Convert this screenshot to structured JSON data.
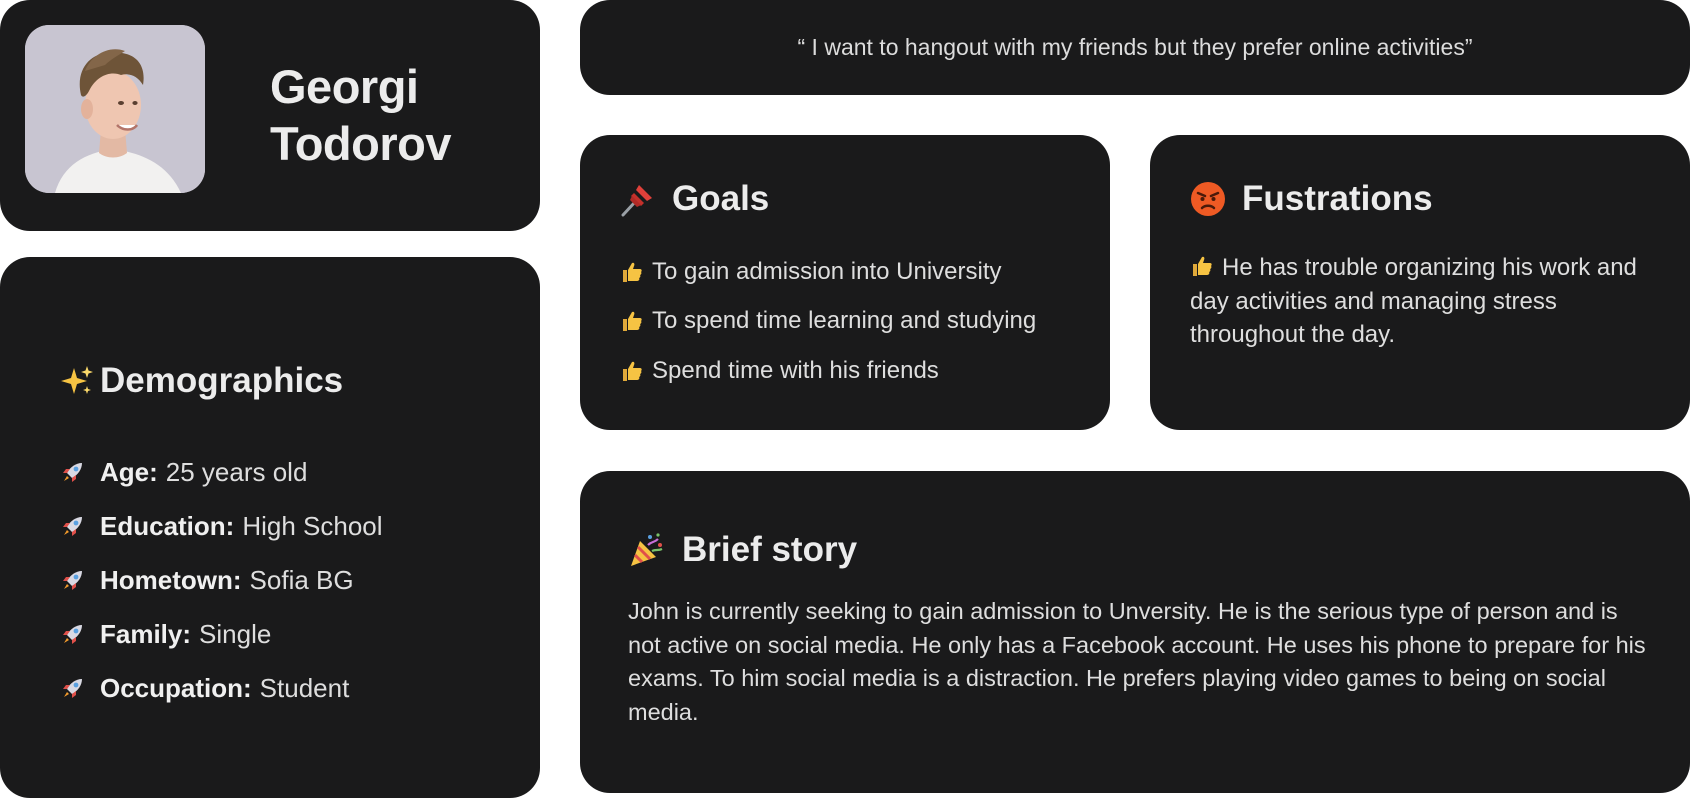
{
  "profile": {
    "first_name": "Georgi",
    "last_name": "Todorov",
    "avatar_alt": "profile photo"
  },
  "quote": {
    "text": "“ I want to hangout with my friends but they prefer online activities”"
  },
  "demographics": {
    "title": "Demographics",
    "items": [
      {
        "label": "Age:",
        "value": "25 years old"
      },
      {
        "label": "Education:",
        "value": "High School"
      },
      {
        "label": "Hometown:",
        "value": "Sofia BG"
      },
      {
        "label": "Family:",
        "value": "Single"
      },
      {
        "label": "Occupation:",
        "value": "Student"
      }
    ]
  },
  "goals": {
    "title": "Goals",
    "items": [
      "To gain admission into University",
      "To spend time learning and studying",
      "Spend time with his friends"
    ]
  },
  "frustrations": {
    "title": "Fustrations",
    "text": "He has trouble organizing his work and day activities and managing stress throughout the day."
  },
  "story": {
    "title": "Brief story",
    "text": "John is currently seeking to gain admission to Unversity. He is the serious type of person and is not active on social media. He only has a Facebook account. He uses his phone to prepare for his exams. To him social media is a distraction. He prefers playing video games to being on social media."
  },
  "icons": {
    "demographics": "sparkles-icon",
    "demo_bullet": "rocket-icon",
    "goals": "pushpin-icon",
    "goal_bullet": "thumbs-up-icon",
    "frustrations": "angry-face-icon",
    "story": "party-popper-icon"
  },
  "colors": {
    "card_bg": "#1a1a1b",
    "page_bg": "#ffffff",
    "text": "#e8e8e8"
  }
}
